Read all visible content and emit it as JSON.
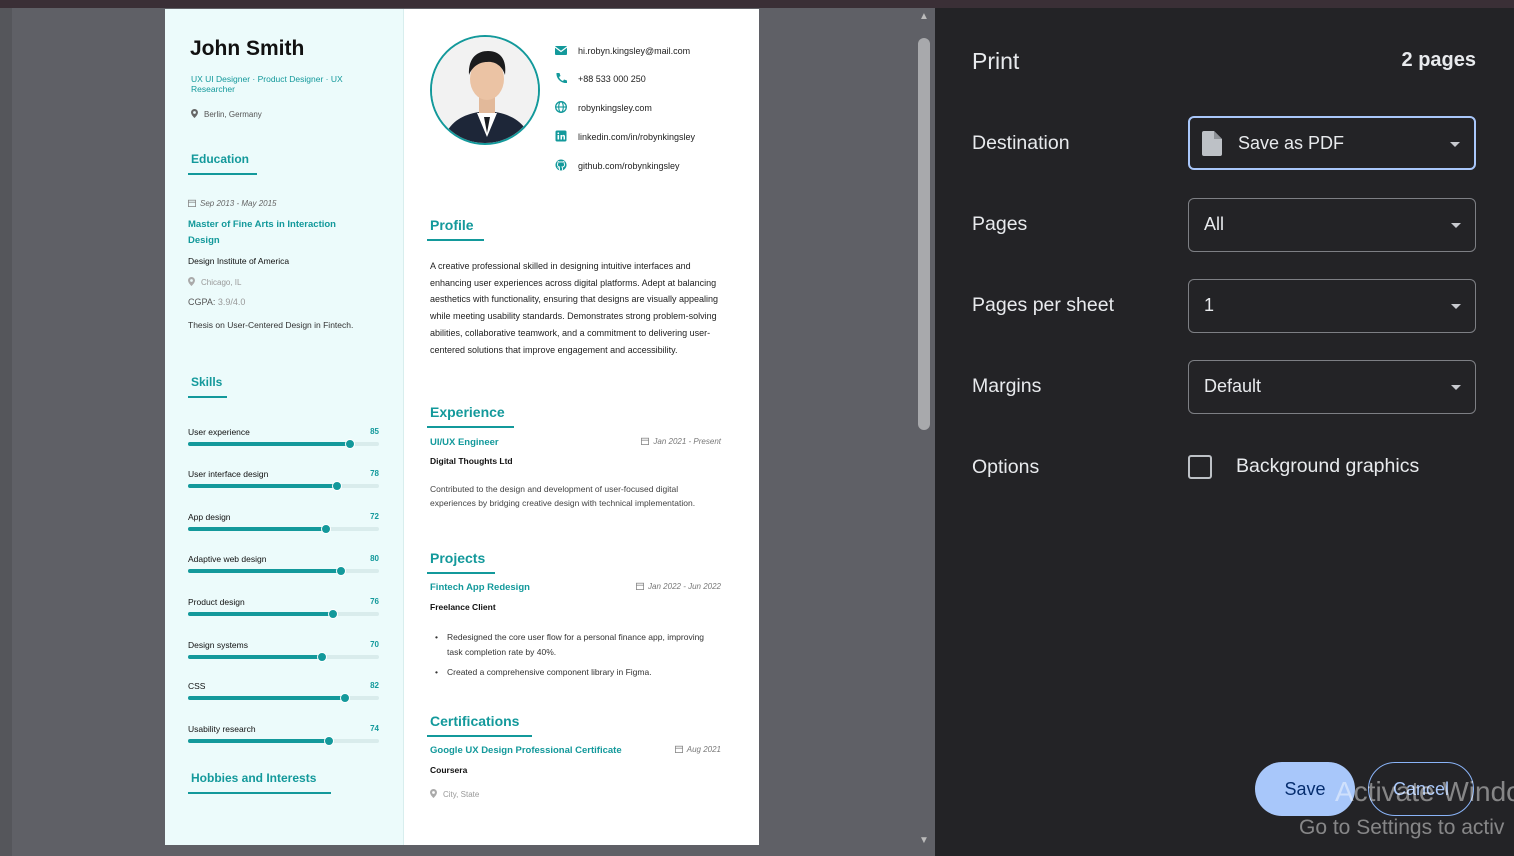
{
  "resume": {
    "name": "John Smith",
    "roles": "UX UI Designer · Product Designer · UX Researcher",
    "location": "Berlin, Germany",
    "education": {
      "heading": "Education",
      "date": "Sep 2013 - May 2015",
      "degree": "Master of Fine Arts in Interaction Design",
      "institution": "Design Institute of America",
      "city": "Chicago, IL",
      "gpa_label": "CGPA: ",
      "gpa_value": "3.9/4.0",
      "thesis": "Thesis on User-Centered Design in Fintech."
    },
    "skills_heading": "Skills",
    "skills": [
      {
        "name": "User experience",
        "level": 85
      },
      {
        "name": "User interface design",
        "level": 78
      },
      {
        "name": "App design",
        "level": 72
      },
      {
        "name": "Adaptive web design",
        "level": 80
      },
      {
        "name": "Product design",
        "level": 76
      },
      {
        "name": "Design systems",
        "level": 70
      },
      {
        "name": "CSS",
        "level": 82
      },
      {
        "name": "Usability research",
        "level": 74
      }
    ],
    "hobbies_heading": "Hobbies and Interests",
    "contacts": [
      {
        "icon": "mail-icon",
        "text": "hi.robyn.kingsley@mail.com"
      },
      {
        "icon": "phone-icon",
        "text": "+88 533 000 250"
      },
      {
        "icon": "globe-icon",
        "text": "robynkingsley.com"
      },
      {
        "icon": "linkedin-icon",
        "text": "linkedin.com/in/robynkingsley"
      },
      {
        "icon": "github-icon",
        "text": "github.com/robynkingsley"
      }
    ],
    "profile": {
      "heading": "Profile",
      "text": "A creative professional skilled in designing intuitive interfaces and enhancing user experiences across digital platforms. Adept at balancing aesthetics with functionality, ensuring that designs are visually appealing while meeting usability standards. Demonstrates strong problem-solving abilities, collaborative teamwork, and a commitment to delivering user-centered solutions that improve engagement and accessibility."
    },
    "experience": {
      "heading": "Experience",
      "title": "UI/UX Engineer",
      "date": "Jan 2021 - Present",
      "company": "Digital Thoughts Ltd",
      "description": "Contributed to the design and development of user-focused digital experiences by bridging creative design with technical implementation."
    },
    "projects": {
      "heading": "Projects",
      "title": "Fintech App Redesign",
      "date": "Jan 2022 - Jun 2022",
      "client": "Freelance Client",
      "bullets": [
        "Redesigned the core user flow for a personal finance app, improving task completion rate by 40%.",
        "Created a comprehensive component library in Figma."
      ]
    },
    "certifications": {
      "heading": "Certifications",
      "title": "Google UX Design Professional Certificate",
      "date": "Aug 2021",
      "issuer": "Coursera",
      "location": "City, State"
    }
  },
  "print": {
    "title": "Print",
    "page_count": "2 pages",
    "destination_label": "Destination",
    "destination_value": "Save as PDF",
    "pages_label": "Pages",
    "pages_value": "All",
    "per_sheet_label": "Pages per sheet",
    "per_sheet_value": "1",
    "margins_label": "Margins",
    "margins_value": "Default",
    "options_label": "Options",
    "background_graphics_label": "Background graphics",
    "background_graphics_checked": false,
    "save_label": "Save",
    "cancel_label": "Cancel"
  },
  "watermark": {
    "line1": "Activate Window",
    "line2": "Go to Settings to activ"
  },
  "colors": {
    "accent": "#13999b",
    "panel_bg": "#232326",
    "save_button": "#a8c7fa"
  }
}
